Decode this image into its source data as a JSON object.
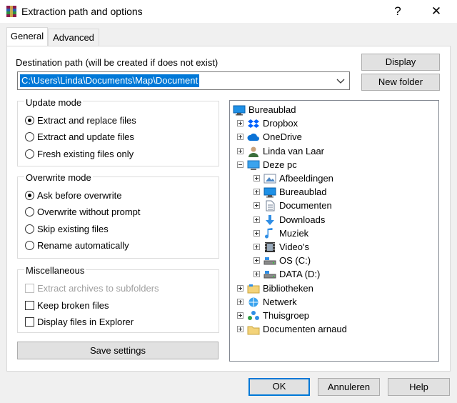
{
  "window": {
    "title": "Extraction path and options",
    "help_label": "?",
    "close_label": "✕"
  },
  "tabs": [
    {
      "label": "General",
      "active": true
    },
    {
      "label": "Advanced",
      "active": false
    }
  ],
  "destination": {
    "label": "Destination path (will be created if does not exist)",
    "value": "C:\\Users\\Linda\\Documents\\Map\\Document"
  },
  "buttons": {
    "display": "Display",
    "new_folder": "New folder",
    "save_settings": "Save settings",
    "ok": "OK",
    "cancel": "Annuleren",
    "help": "Help"
  },
  "update_mode": {
    "title": "Update mode",
    "options": [
      {
        "label": "Extract and replace files",
        "selected": true
      },
      {
        "label": "Extract and update files",
        "selected": false
      },
      {
        "label": "Fresh existing files only",
        "selected": false
      }
    ]
  },
  "overwrite_mode": {
    "title": "Overwrite mode",
    "options": [
      {
        "label": "Ask before overwrite",
        "selected": true
      },
      {
        "label": "Overwrite without prompt",
        "selected": false
      },
      {
        "label": "Skip existing files",
        "selected": false
      },
      {
        "label": "Rename automatically",
        "selected": false
      }
    ]
  },
  "misc": {
    "title": "Miscellaneous",
    "options": [
      {
        "label": "Extract archives to subfolders",
        "checked": false,
        "disabled": true
      },
      {
        "label": "Keep broken files",
        "checked": false,
        "disabled": false
      },
      {
        "label": "Display files in Explorer",
        "checked": false,
        "disabled": false
      }
    ]
  },
  "tree": [
    {
      "label": "Bureaublad",
      "icon": "desktop-icon",
      "level": 0,
      "expander": "none"
    },
    {
      "label": "Dropbox",
      "icon": "dropbox-icon",
      "level": 1,
      "expander": "plus"
    },
    {
      "label": "OneDrive",
      "icon": "cloud-icon",
      "level": 1,
      "expander": "plus"
    },
    {
      "label": "Linda van Laar",
      "icon": "user-icon",
      "level": 1,
      "expander": "plus"
    },
    {
      "label": "Deze pc",
      "icon": "computer-icon",
      "level": 1,
      "expander": "minus"
    },
    {
      "label": "Afbeeldingen",
      "icon": "pictures-icon",
      "level": 2,
      "expander": "plus"
    },
    {
      "label": "Bureaublad",
      "icon": "desktop-icon",
      "level": 2,
      "expander": "plus"
    },
    {
      "label": "Documenten",
      "icon": "document-icon",
      "level": 2,
      "expander": "plus"
    },
    {
      "label": "Downloads",
      "icon": "download-icon",
      "level": 2,
      "expander": "plus"
    },
    {
      "label": "Muziek",
      "icon": "music-icon",
      "level": 2,
      "expander": "plus"
    },
    {
      "label": "Video's",
      "icon": "video-icon",
      "level": 2,
      "expander": "plus"
    },
    {
      "label": "OS (C:)",
      "icon": "drive-icon",
      "level": 2,
      "expander": "plus"
    },
    {
      "label": "DATA (D:)",
      "icon": "drive-icon",
      "level": 2,
      "expander": "plus"
    },
    {
      "label": "Bibliotheken",
      "icon": "library-icon",
      "level": 1,
      "expander": "plus"
    },
    {
      "label": "Netwerk",
      "icon": "network-icon",
      "level": 1,
      "expander": "plus"
    },
    {
      "label": "Thuisgroep",
      "icon": "homegroup-icon",
      "level": 1,
      "expander": "plus"
    },
    {
      "label": "Documenten arnaud",
      "icon": "folder-icon",
      "level": 1,
      "expander": "plus"
    }
  ],
  "colors": {
    "accent": "#0078d7",
    "folder": "#f3d37a",
    "dropbox": "#0061fe"
  }
}
